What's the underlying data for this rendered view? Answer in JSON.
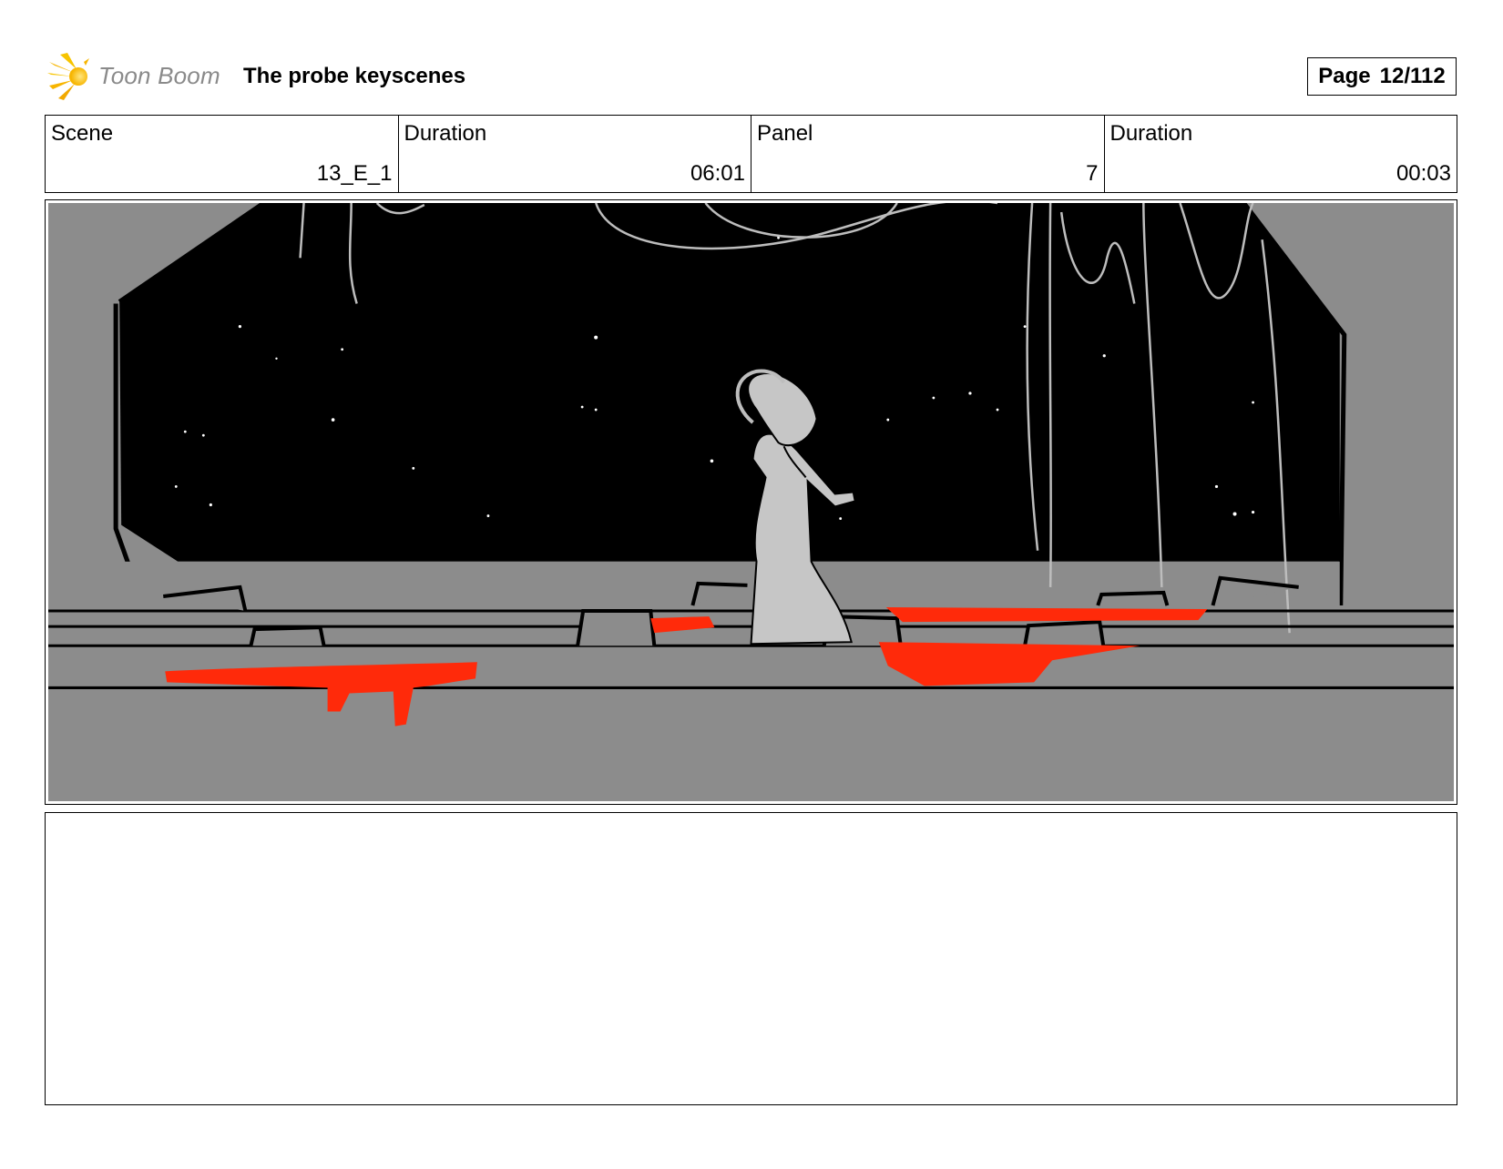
{
  "header": {
    "logo_text": "Toon Boom",
    "project_title": "The probe keyscenes",
    "page_label": "Page",
    "page_number": "12/112"
  },
  "info": [
    {
      "label": "Scene",
      "value": "13_E_1"
    },
    {
      "label": "Duration",
      "value": "06:01"
    },
    {
      "label": "Panel",
      "value": "7"
    },
    {
      "label": "Duration",
      "value": "00:03"
    }
  ],
  "colors": {
    "sky": "#000000",
    "floor": "#8c8c8c",
    "blood": "#ff2a0a",
    "figure": "#c6c6c6"
  }
}
